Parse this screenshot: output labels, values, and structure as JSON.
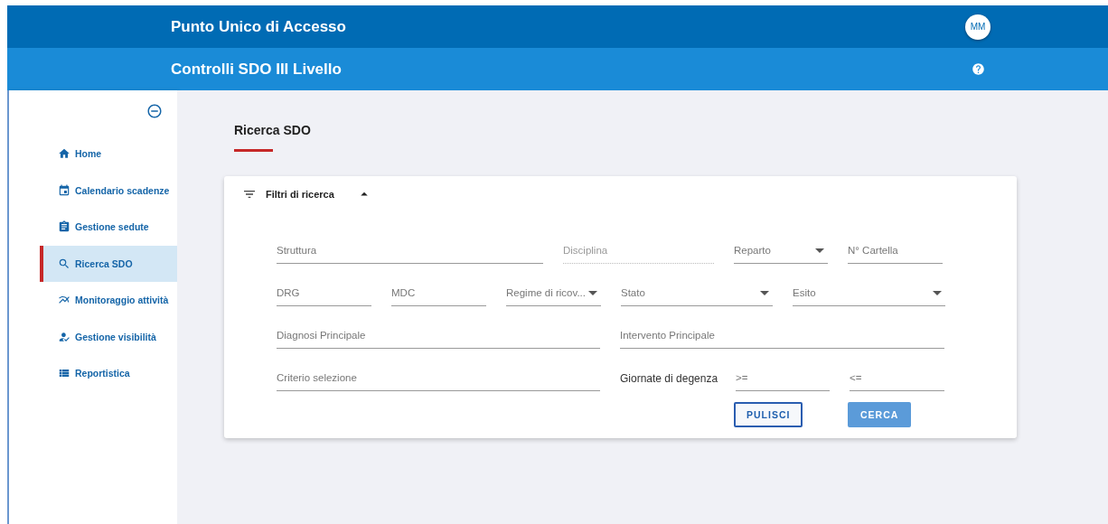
{
  "header": {
    "title": "Punto Unico di Accesso",
    "avatar": "MM"
  },
  "subheader": {
    "title": "Controlli SDO III Livello"
  },
  "sidebar": {
    "items": [
      {
        "label": "Home",
        "selected": false
      },
      {
        "label": "Calendario scadenze",
        "selected": false
      },
      {
        "label": "Gestione sedute",
        "selected": false
      },
      {
        "label": "Ricerca SDO",
        "selected": true
      },
      {
        "label": "Monitoraggio attività",
        "selected": false
      },
      {
        "label": "Gestione visibilità",
        "selected": false
      },
      {
        "label": "Reportistica",
        "selected": false
      }
    ]
  },
  "page": {
    "title": "Ricerca SDO"
  },
  "filters": {
    "title": "Filtri di ricerca",
    "expanded": true,
    "groups": [
      {
        "fields": [
          {
            "kind": "input",
            "placeholder": "Struttura"
          },
          {
            "kind": "input",
            "placeholder": "Disciplina",
            "disabled": true
          },
          {
            "kind": "select",
            "placeholder": "Reparto"
          },
          {
            "kind": "input",
            "placeholder": "N° Cartella"
          }
        ]
      },
      {
        "fields": [
          {
            "kind": "input",
            "placeholder": "DRG"
          },
          {
            "kind": "input",
            "placeholder": "MDC"
          },
          {
            "kind": "select",
            "placeholder": "Regime di ricov..."
          },
          {
            "kind": "select",
            "placeholder": "Stato"
          },
          {
            "kind": "select",
            "placeholder": "Esito"
          }
        ]
      },
      {
        "fields": [
          {
            "kind": "input",
            "placeholder": "Diagnosi Principale"
          },
          {
            "kind": "input",
            "placeholder": "Intervento Principale"
          }
        ]
      },
      {
        "fields": [
          {
            "kind": "input",
            "placeholder": "Criterio selezione"
          },
          {
            "kind": "label",
            "text": "Giornate di degenza"
          },
          {
            "kind": "input",
            "placeholder": ">="
          },
          {
            "kind": "input",
            "placeholder": "<="
          }
        ]
      }
    ],
    "buttons": [
      {
        "label": "PULISCI",
        "kind": "outline"
      },
      {
        "label": "CERCA",
        "kind": "filled"
      }
    ]
  }
}
